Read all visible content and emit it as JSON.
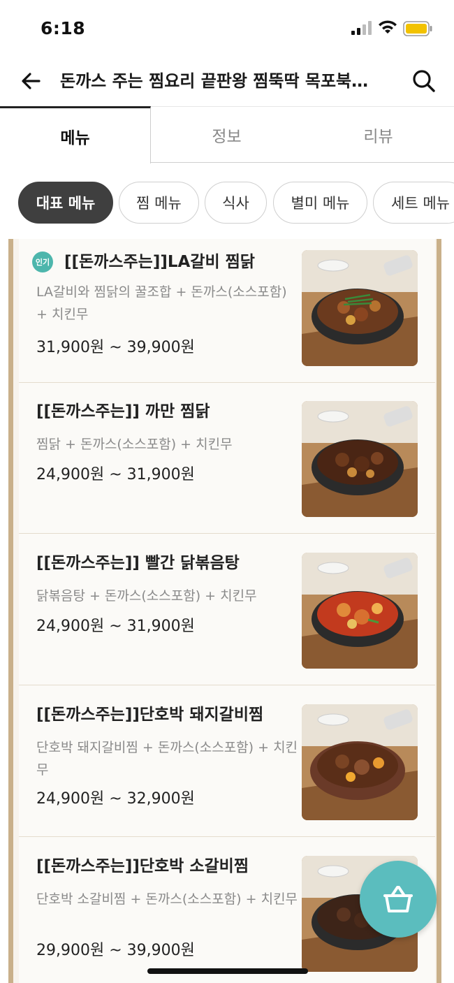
{
  "status_bar": {
    "time": "6:18"
  },
  "header": {
    "title": "돈까스 주는 찜요리 끝판왕 찜뚝딱 목포북…"
  },
  "tabs": [
    {
      "label": "메뉴",
      "active": true
    },
    {
      "label": "정보",
      "active": false
    },
    {
      "label": "리뷰",
      "active": false
    }
  ],
  "categories": [
    {
      "label": "대표 메뉴",
      "active": true
    },
    {
      "label": "찜 메뉴",
      "active": false
    },
    {
      "label": "식사",
      "active": false
    },
    {
      "label": "별미 메뉴",
      "active": false
    },
    {
      "label": "세트 메뉴",
      "active": false
    }
  ],
  "menu_items": [
    {
      "badge": "인기",
      "name": "[[돈까스주는]]LA갈비 찜닭",
      "description": "LA갈비와 찜닭의 꿀조합 + 돈까스(소스포함) + 치킨무",
      "price": "31,900원 ~ 39,900원",
      "sauce_color": "#6b3a1e"
    },
    {
      "badge": "",
      "name": "[[돈까스주는]] 까만 찜닭",
      "description": "찜닭 + 돈까스(소스포함) + 치킨무",
      "price": "24,900원 ~ 31,900원",
      "sauce_color": "#4a2514"
    },
    {
      "badge": "",
      "name": "[[돈까스주는]] 빨간 닭볶음탕",
      "description": "닭볶음탕 + 돈까스(소스포함) + 치킨무",
      "price": "24,900원 ~ 31,900원",
      "sauce_color": "#c23a1e"
    },
    {
      "badge": "",
      "name": "[[돈까스주는]]단호박 돼지갈비찜",
      "description": "단호박 돼지갈비찜 + 돈까스(소스포함) + 치킨무",
      "price": "24,900원 ~ 32,900원",
      "sauce_color": "#5a2e18"
    },
    {
      "badge": "",
      "name": "[[돈까스주는]]단호박 소갈비찜",
      "description": "단호박 소갈비찜 + 돈까스(소스포함) + 치킨무",
      "price": "29,900원 ~ 39,900원",
      "sauce_color": "#3d2418"
    }
  ],
  "colors": {
    "accent": "#5bbdbe",
    "badge": "#4db6ac",
    "chip_active": "#3f3f3f",
    "frame": "#c9b08a"
  },
  "icons": {
    "back": "arrow-left-icon",
    "search": "search-icon",
    "cart": "basket-icon"
  }
}
